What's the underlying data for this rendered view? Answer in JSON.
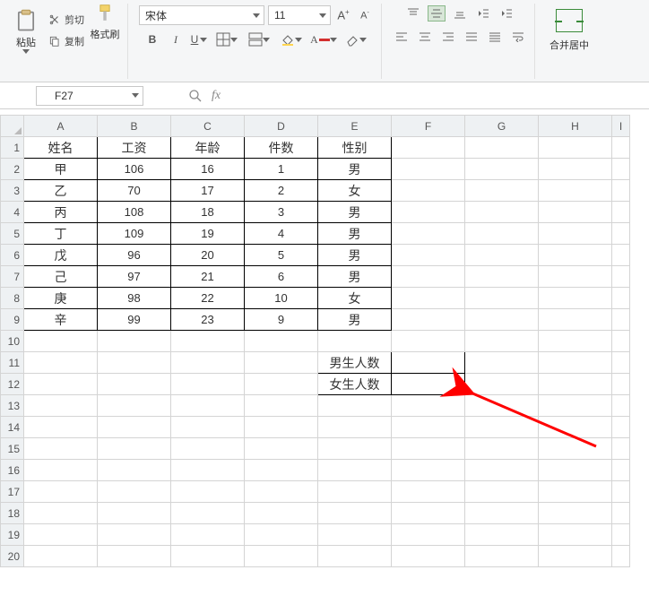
{
  "ribbon": {
    "paste_label": "粘贴",
    "cut_label": "剪切",
    "copy_label": "复制",
    "format_painter_label": "格式刷",
    "merge_label": "合并居中"
  },
  "font": {
    "name": "宋体",
    "size": "11",
    "bold": "B",
    "italic": "I",
    "underline": "U"
  },
  "name_box": {
    "value": "F27"
  },
  "columns": [
    "A",
    "B",
    "C",
    "D",
    "E",
    "F",
    "G",
    "H",
    "I"
  ],
  "row_count": 20,
  "headers": [
    "姓名",
    "工资",
    "年龄",
    "件数",
    "性别"
  ],
  "data_rows": [
    {
      "a": "甲",
      "b": "106",
      "c": "16",
      "d": "1",
      "e": "男"
    },
    {
      "a": "乙",
      "b": "70",
      "c": "17",
      "d": "2",
      "e": "女"
    },
    {
      "a": "丙",
      "b": "108",
      "c": "18",
      "d": "3",
      "e": "男"
    },
    {
      "a": "丁",
      "b": "109",
      "c": "19",
      "d": "4",
      "e": "男"
    },
    {
      "a": "戊",
      "b": "96",
      "c": "20",
      "d": "5",
      "e": "男"
    },
    {
      "a": "己",
      "b": "97",
      "c": "21",
      "d": "6",
      "e": "男"
    },
    {
      "a": "庚",
      "b": "98",
      "c": "22",
      "d": "10",
      "e": "女"
    },
    {
      "a": "辛",
      "b": "99",
      "c": "23",
      "d": "9",
      "e": "男"
    }
  ],
  "summary": {
    "male_label": "男生人数",
    "female_label": "女生人数"
  }
}
